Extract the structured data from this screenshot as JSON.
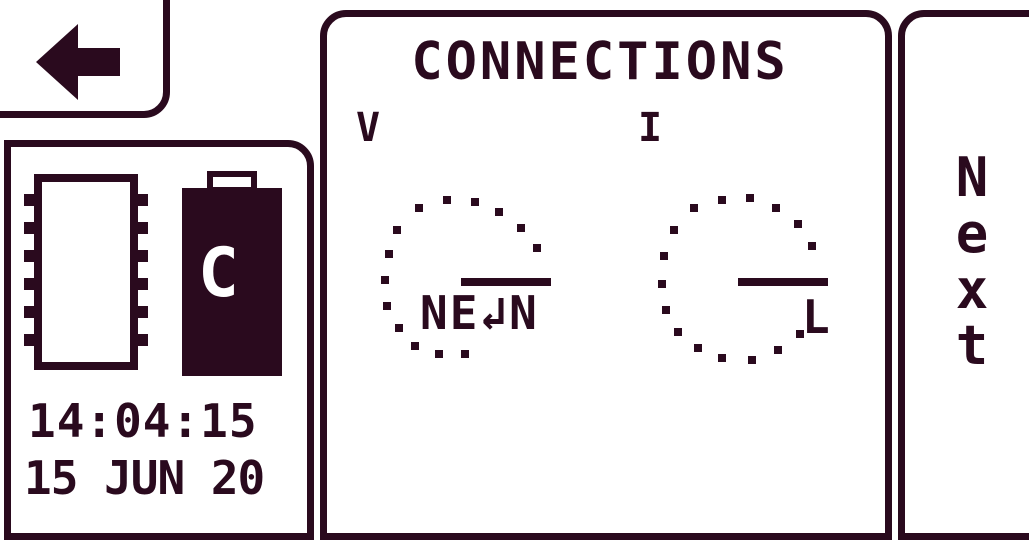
{
  "header": {
    "title": "CONNECTIONS"
  },
  "nav": {
    "back_icon": "arrow-left-icon",
    "next_label": [
      "N",
      "e",
      "x",
      "t"
    ]
  },
  "status": {
    "memory_icon": "memory-chip-icon",
    "battery_icon": "battery-icon",
    "battery_label": "C",
    "time": "14:04:15",
    "date": "15 JUN 20"
  },
  "connections": {
    "voltage_label": "V",
    "current_label": "I",
    "voltage_connection": "NE↲N",
    "current_connection": "L"
  },
  "colors": {
    "foreground": "#2a0a1e",
    "background": "#ffffff"
  }
}
